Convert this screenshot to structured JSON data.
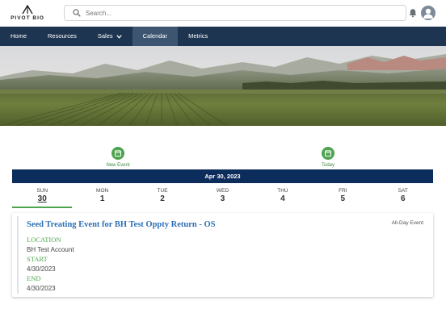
{
  "brand": {
    "name": "PIVOT BIO"
  },
  "search": {
    "placeholder": "Search..."
  },
  "nav": {
    "items": [
      {
        "label": "Home"
      },
      {
        "label": "Resources"
      },
      {
        "label": "Sales"
      },
      {
        "label": "Calendar"
      },
      {
        "label": "Metrics"
      }
    ]
  },
  "actions": {
    "new_event": "New Event",
    "today": "Today"
  },
  "calendar": {
    "date_header": "Apr 30, 2023",
    "days": [
      {
        "name": "SUN",
        "num": "30"
      },
      {
        "name": "MON",
        "num": "1"
      },
      {
        "name": "TUE",
        "num": "2"
      },
      {
        "name": "WED",
        "num": "3"
      },
      {
        "name": "THU",
        "num": "4"
      },
      {
        "name": "FRI",
        "num": "5"
      },
      {
        "name": "SAT",
        "num": "6"
      }
    ]
  },
  "event": {
    "title": "Seed Treating Event for BH Test Oppty Return - OS",
    "all_day": "All-Day Event",
    "location_label": "LOCATION",
    "location": "BH Test Account",
    "start_label": "START",
    "start": "4/30/2023",
    "end_label": "END",
    "end": "4/30/2023"
  },
  "colors": {
    "nav_bg": "#1e3551",
    "nav_active": "#3e5571",
    "date_bar": "#0c2c5c",
    "accent_green": "#4ea44e",
    "link_blue": "#2d6fb5"
  }
}
